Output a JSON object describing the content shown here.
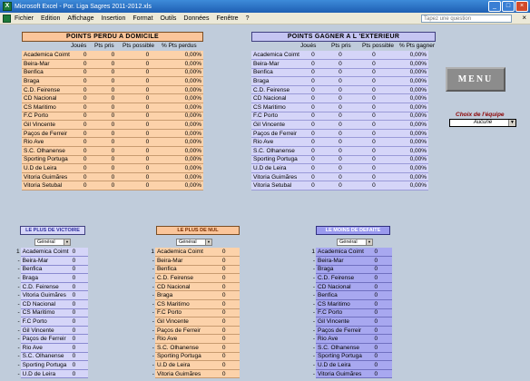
{
  "window": {
    "title": "Microsoft Excel - Por. Liga Sagres 2011-2012.xls",
    "buttons": [
      "_",
      "□",
      "×"
    ]
  },
  "menubar": {
    "items": [
      "Fichier",
      "Edition",
      "Affichage",
      "Insertion",
      "Format",
      "Outils",
      "Données",
      "Fenêtre",
      "?"
    ],
    "help_placeholder": "Tapez une question",
    "close": "×"
  },
  "sheet": {
    "domicile": {
      "title": "POINTS PERDU A DOMICILE",
      "columns": [
        "Joués",
        "Pts pris",
        "Pts possible",
        "% Pts perdus"
      ],
      "rows": [
        [
          "Academica Coimt",
          "0",
          "0",
          "0",
          "0,00%"
        ],
        [
          "Beira-Mar",
          "0",
          "0",
          "0",
          "0,00%"
        ],
        [
          "Benfica",
          "0",
          "0",
          "0",
          "0,00%"
        ],
        [
          "Braga",
          "0",
          "0",
          "0",
          "0,00%"
        ],
        [
          "C.D. Feirense",
          "0",
          "0",
          "0",
          "0,00%"
        ],
        [
          "CD Nacional",
          "0",
          "0",
          "0",
          "0,00%"
        ],
        [
          "CS Maritimo",
          "0",
          "0",
          "0",
          "0,00%"
        ],
        [
          "F.C Porto",
          "0",
          "0",
          "0",
          "0,00%"
        ],
        [
          "Gil Vincente",
          "0",
          "0",
          "0",
          "0,00%"
        ],
        [
          "Paços de Ferreir",
          "0",
          "0",
          "0",
          "0,00%"
        ],
        [
          "Rio Ave",
          "0",
          "0",
          "0",
          "0,00%"
        ],
        [
          "S.C. Olhanense",
          "0",
          "0",
          "0",
          "0,00%"
        ],
        [
          "Sporting Portuga",
          "0",
          "0",
          "0",
          "0,00%"
        ],
        [
          "U.D de Leira",
          "0",
          "0",
          "0",
          "0,00%"
        ],
        [
          "Vitoria Guimãres",
          "0",
          "0",
          "0",
          "0,00%"
        ],
        [
          "Vitoria Setubal",
          "0",
          "0",
          "0",
          "0,00%"
        ]
      ]
    },
    "exterieur": {
      "title": "POINTS GAGNER A L 'EXTERIEUR",
      "columns": [
        "Joués",
        "Pts pris",
        "Pts possible",
        "% Pts gagner"
      ],
      "rows": [
        [
          "Academica Coimt",
          "0",
          "0",
          "0",
          "0,00%"
        ],
        [
          "Beira-Mar",
          "0",
          "0",
          "0",
          "0,00%"
        ],
        [
          "Benfica",
          "0",
          "0",
          "0",
          "0,00%"
        ],
        [
          "Braga",
          "0",
          "0",
          "0",
          "0,00%"
        ],
        [
          "C.D. Feirense",
          "0",
          "0",
          "0",
          "0,00%"
        ],
        [
          "CD Nacional",
          "0",
          "0",
          "0",
          "0,00%"
        ],
        [
          "CS Maritimo",
          "0",
          "0",
          "0",
          "0,00%"
        ],
        [
          "F.C Porto",
          "0",
          "0",
          "0",
          "0,00%"
        ],
        [
          "Gil Vincente",
          "0",
          "0",
          "0",
          "0,00%"
        ],
        [
          "Paços de Ferreir",
          "0",
          "0",
          "0",
          "0,00%"
        ],
        [
          "Rio Ave",
          "0",
          "0",
          "0",
          "0,00%"
        ],
        [
          "S.C. Olhanense",
          "0",
          "0",
          "0",
          "0,00%"
        ],
        [
          "Sporting Portuga",
          "0",
          "0",
          "0",
          "0,00%"
        ],
        [
          "U.D de Leira",
          "0",
          "0",
          "0",
          "0,00%"
        ],
        [
          "Vitoria Guimãres",
          "0",
          "0",
          "0",
          "0,00%"
        ],
        [
          "Vitoria Setubal",
          "0",
          "0",
          "0",
          "0,00%"
        ]
      ]
    },
    "menu_button": "MENU",
    "choix": {
      "label": "Choix de l'équipe",
      "value": "Aucune"
    },
    "victoire": {
      "title": "LE PLUS DE VICTOIRE",
      "filter": "Général",
      "rows": [
        [
          "1",
          "Academica Coimt",
          "0"
        ],
        [
          "-",
          "Beira-Mar",
          "0"
        ],
        [
          "-",
          "Benfica",
          "0"
        ],
        [
          "-",
          "Braga",
          "0"
        ],
        [
          "-",
          "C.D. Feirense",
          "0"
        ],
        [
          "-",
          "Vitoria Guimãres",
          "0"
        ],
        [
          "-",
          "CD Nacional",
          "0"
        ],
        [
          "-",
          "CS Maritimo",
          "0"
        ],
        [
          "-",
          "F.C Porto",
          "0"
        ],
        [
          "-",
          "Gil Vincente",
          "0"
        ],
        [
          "-",
          "Paços de Ferreir",
          "0"
        ],
        [
          "-",
          "Rio Ave",
          "0"
        ],
        [
          "-",
          "S.C. Olhanense",
          "0"
        ],
        [
          "-",
          "Sporting Portuga",
          "0"
        ],
        [
          "-",
          "U.D de Leira",
          "0"
        ]
      ]
    },
    "nul": {
      "title": "LE PLUS DE NUL",
      "filter": "Général",
      "rows": [
        [
          "1",
          "Academica Coimt",
          "0"
        ],
        [
          "-",
          "Beira-Mar",
          "0"
        ],
        [
          "-",
          "Benfica",
          "0"
        ],
        [
          "-",
          "C.D. Feirense",
          "0"
        ],
        [
          "-",
          "CD Nacional",
          "0"
        ],
        [
          "-",
          "Braga",
          "0"
        ],
        [
          "-",
          "CS Maritimo",
          "0"
        ],
        [
          "-",
          "F.C Porto",
          "0"
        ],
        [
          "-",
          "Gil Vincente",
          "0"
        ],
        [
          "-",
          "Paços de Ferreir",
          "0"
        ],
        [
          "-",
          "Rio Ave",
          "0"
        ],
        [
          "-",
          "S.C. Olhanense",
          "0"
        ],
        [
          "-",
          "Sporting Portuga",
          "0"
        ],
        [
          "-",
          "U.D de Leira",
          "0"
        ],
        [
          "-",
          "Vitoria Guimãres",
          "0"
        ]
      ]
    },
    "defaite": {
      "title": "LE MOINS DE DEFAITE",
      "filter": "Général",
      "rows": [
        [
          "1",
          "Academica Coimt",
          "0"
        ],
        [
          "-",
          "Beira-Mar",
          "0"
        ],
        [
          "-",
          "Braga",
          "0"
        ],
        [
          "-",
          "C.D. Feirense",
          "0"
        ],
        [
          "-",
          "CD Nacional",
          "0"
        ],
        [
          "-",
          "Benfica",
          "0"
        ],
        [
          "-",
          "CS Maritimo",
          "0"
        ],
        [
          "-",
          "F.C Porto",
          "0"
        ],
        [
          "-",
          "Gil Vincente",
          "0"
        ],
        [
          "-",
          "Paços de Ferreir",
          "0"
        ],
        [
          "-",
          "Rio Ave",
          "0"
        ],
        [
          "-",
          "S.C. Olhanense",
          "0"
        ],
        [
          "-",
          "Sporting Portuga",
          "0"
        ],
        [
          "-",
          "U.D de Leira",
          "0"
        ],
        [
          "-",
          "Vitoria Guimãres",
          "0"
        ]
      ]
    }
  }
}
